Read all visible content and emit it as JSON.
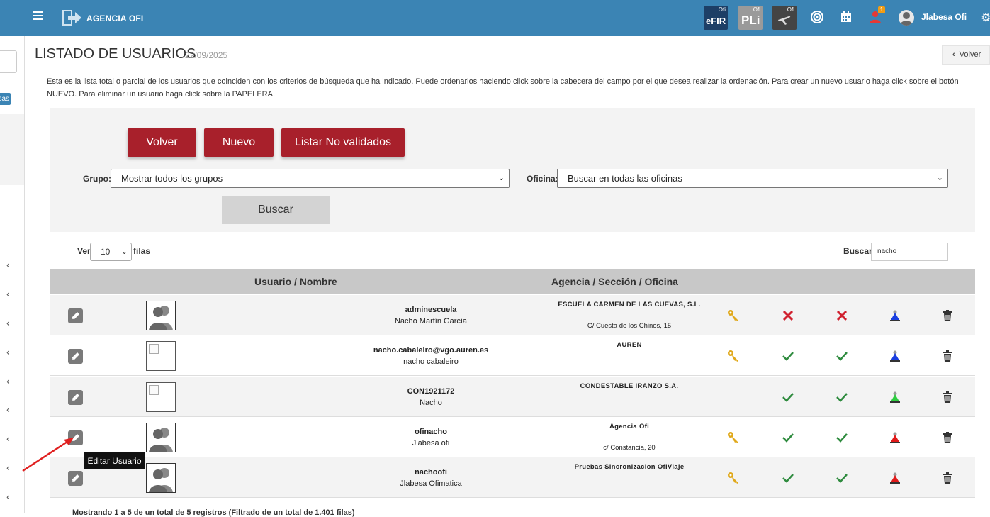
{
  "topbar": {
    "brand": "AGENCIA OFI",
    "tiles": [
      {
        "sup": "Ofi",
        "label": "eFIR",
        "bg": "#1d3f66"
      },
      {
        "sup": "Ofi",
        "label": "PLi",
        "bg": "#9a9a9a"
      },
      {
        "sup": "Ofi",
        "label": "",
        "bg": "#444444"
      }
    ],
    "notification_count": "1",
    "username": "Jlabesa Ofi"
  },
  "page": {
    "title": "LISTADO DE USUARIOS",
    "date": "22/09/2025",
    "back_label": "Volver",
    "intro": "Esta es la lista total o parcial de los usuarios que coinciden con los criterios de búsqueda que ha indicado. Puede ordenarlos haciendo click sobre la cabecera del campo por el que desea realizar la ordenación. Para crear un nuevo usuario haga click sobre el botón NUEVO. Para eliminar un usuario haga click sobre la PAPELERA."
  },
  "filters": {
    "buttons": [
      "Volver",
      "Nuevo",
      "Listar No validados"
    ],
    "grupo_label": "Grupo:",
    "grupo_value": "Mostrar todos los grupos",
    "oficina_label": "Oficina:",
    "oficina_value": "Buscar en todas las oficinas",
    "search_button": "Buscar"
  },
  "table_controls": {
    "ver_label": "Ver",
    "ver_value": "10",
    "filas_label": "filas",
    "buscar_label": "Buscar:",
    "buscar_value": "nacho"
  },
  "table": {
    "headers": [
      "Usuario / Nombre",
      "Agencia / Sección / Oficina"
    ],
    "rows": [
      {
        "user": "adminescuela",
        "name": "Nacho Martín García",
        "agency": "ESCUELA CARMEN DE LAS CUEVAS, S.L.",
        "address": "C/ Cuesta de los Chinos, 15",
        "photo": "avatar",
        "key": true,
        "check1": "no",
        "check2": "no",
        "person_color": "#1a3ee0"
      },
      {
        "user": "nacho.cabaleiro@vgo.auren.es",
        "name": "nacho cabaleiro",
        "agency": "AUREN",
        "address": "",
        "photo": "broken",
        "key": true,
        "check1": "yes",
        "check2": "yes",
        "person_color": "#1a3ee0"
      },
      {
        "user": "CON1921172",
        "name": "Nacho",
        "agency": "CONDESTABLE IRANZO S.A.",
        "address": "",
        "photo": "broken",
        "key": false,
        "check1": "yes",
        "check2": "yes",
        "person_color": "#2ecc40"
      },
      {
        "user": "ofinacho",
        "name": "Jlabesa ofi",
        "agency": "Agencia Ofi",
        "address": "c/ Constancia, 20",
        "photo": "avatar",
        "key": true,
        "check1": "yes",
        "check2": "yes",
        "person_color": "#e01a1a"
      },
      {
        "user": "nachoofi",
        "name": "Jlabesa Ofimatica",
        "agency": "Pruebas Sincronizacion OfiViaje",
        "address": "",
        "photo": "avatar",
        "key": true,
        "check1": "yes",
        "check2": "yes",
        "person_color": "#e01a1a"
      }
    ]
  },
  "tooltip": "Editar Usuario",
  "footer": "Mostrando 1 a 5 de un total de 5 registros (Filtrado de un total de 1.401 filas)",
  "colors": {
    "topbar": "#3b84b4",
    "accent_red": "#a8202b",
    "check_green": "#2e8b3e",
    "cross_red": "#d0202e",
    "key_gold": "#e0a81a"
  }
}
